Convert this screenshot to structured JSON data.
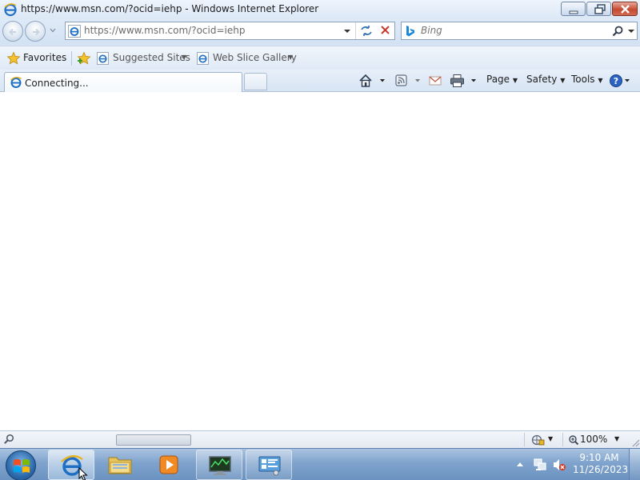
{
  "window": {
    "title": "https://www.msn.com/?ocid=iehp - Windows Internet Explorer"
  },
  "address_bar": {
    "value": "https://www.msn.com/?ocid=iehp"
  },
  "search_box": {
    "placeholder": "Bing"
  },
  "favorites_bar": {
    "favorites_label": "Favorites",
    "suggested_sites_label": "Suggested Sites",
    "web_slice_gallery_label": "Web Slice Gallery"
  },
  "tab": {
    "title": "Connecting..."
  },
  "command_bar": {
    "page_label": "Page",
    "safety_label": "Safety",
    "tools_label": "Tools"
  },
  "status_bar": {
    "zoom_level": "100%"
  },
  "taskbar": {
    "time": "9:10 AM",
    "date": "11/26/2023"
  },
  "colors": {
    "chrome_blue": "#dbe8f6",
    "taskbar_blue": "#7fa3cd",
    "close_red": "#c44a32",
    "ie_blue": "#1f6fc4"
  }
}
